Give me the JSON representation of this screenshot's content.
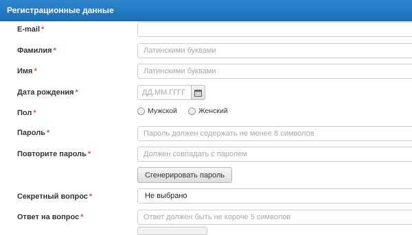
{
  "panel": {
    "title": "Регистрационные данные"
  },
  "required_mark": "*",
  "fields": {
    "email": {
      "label": "E-mail",
      "value": "",
      "placeholder": ""
    },
    "last_name": {
      "label": "Фамилия",
      "placeholder": "Латинскими буквами"
    },
    "first_name": {
      "label": "Имя",
      "placeholder": "Латинскими буквами"
    },
    "birth_date": {
      "label": "Дата рождения",
      "placeholder": "ДД.ММ.ГГГГ",
      "icon": "calendar-icon"
    },
    "gender": {
      "label": "Пол",
      "options": [
        "Мужской",
        "Женский"
      ]
    },
    "password": {
      "label": "Пароль",
      "placeholder": "Пароль должен содержать не менее 8 символов"
    },
    "password_repeat": {
      "label": "Повторите пароль",
      "placeholder": "Должен совпадать с паролем"
    },
    "generate_button": {
      "label": "Сгенерировать пароль"
    },
    "secret_question": {
      "label": "Секретный вопрос",
      "selected": "Не выбрано"
    },
    "secret_answer": {
      "label": "Ответ на вопрос",
      "placeholder": "Ответ должен быть не короче 5 символов"
    }
  },
  "colors": {
    "header": "#1f74bf",
    "required": "#e0503a",
    "border": "#cccccc"
  }
}
